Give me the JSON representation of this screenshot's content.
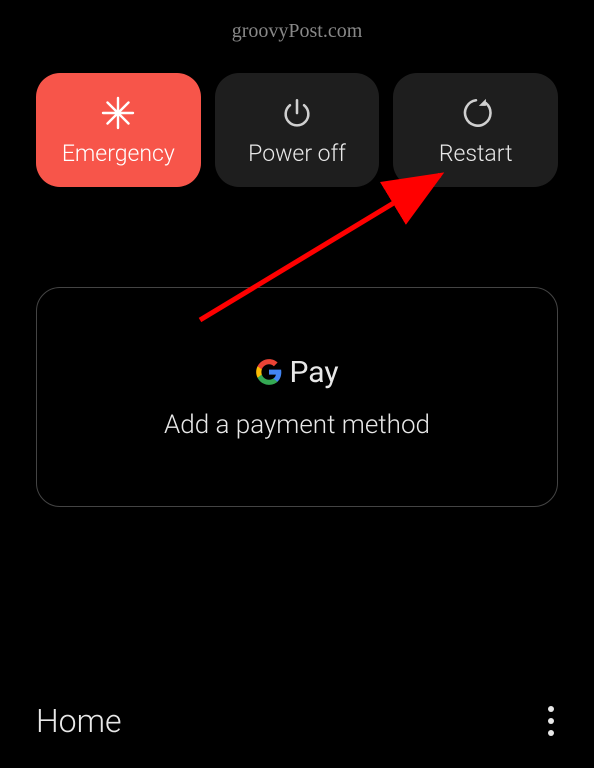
{
  "watermark": "groovyPost.com",
  "power": {
    "emergency_label": "Emergency",
    "poweroff_label": "Power off",
    "restart_label": "Restart"
  },
  "pay": {
    "brand": "Pay",
    "message": "Add a payment method"
  },
  "bottom": {
    "home_label": "Home"
  }
}
